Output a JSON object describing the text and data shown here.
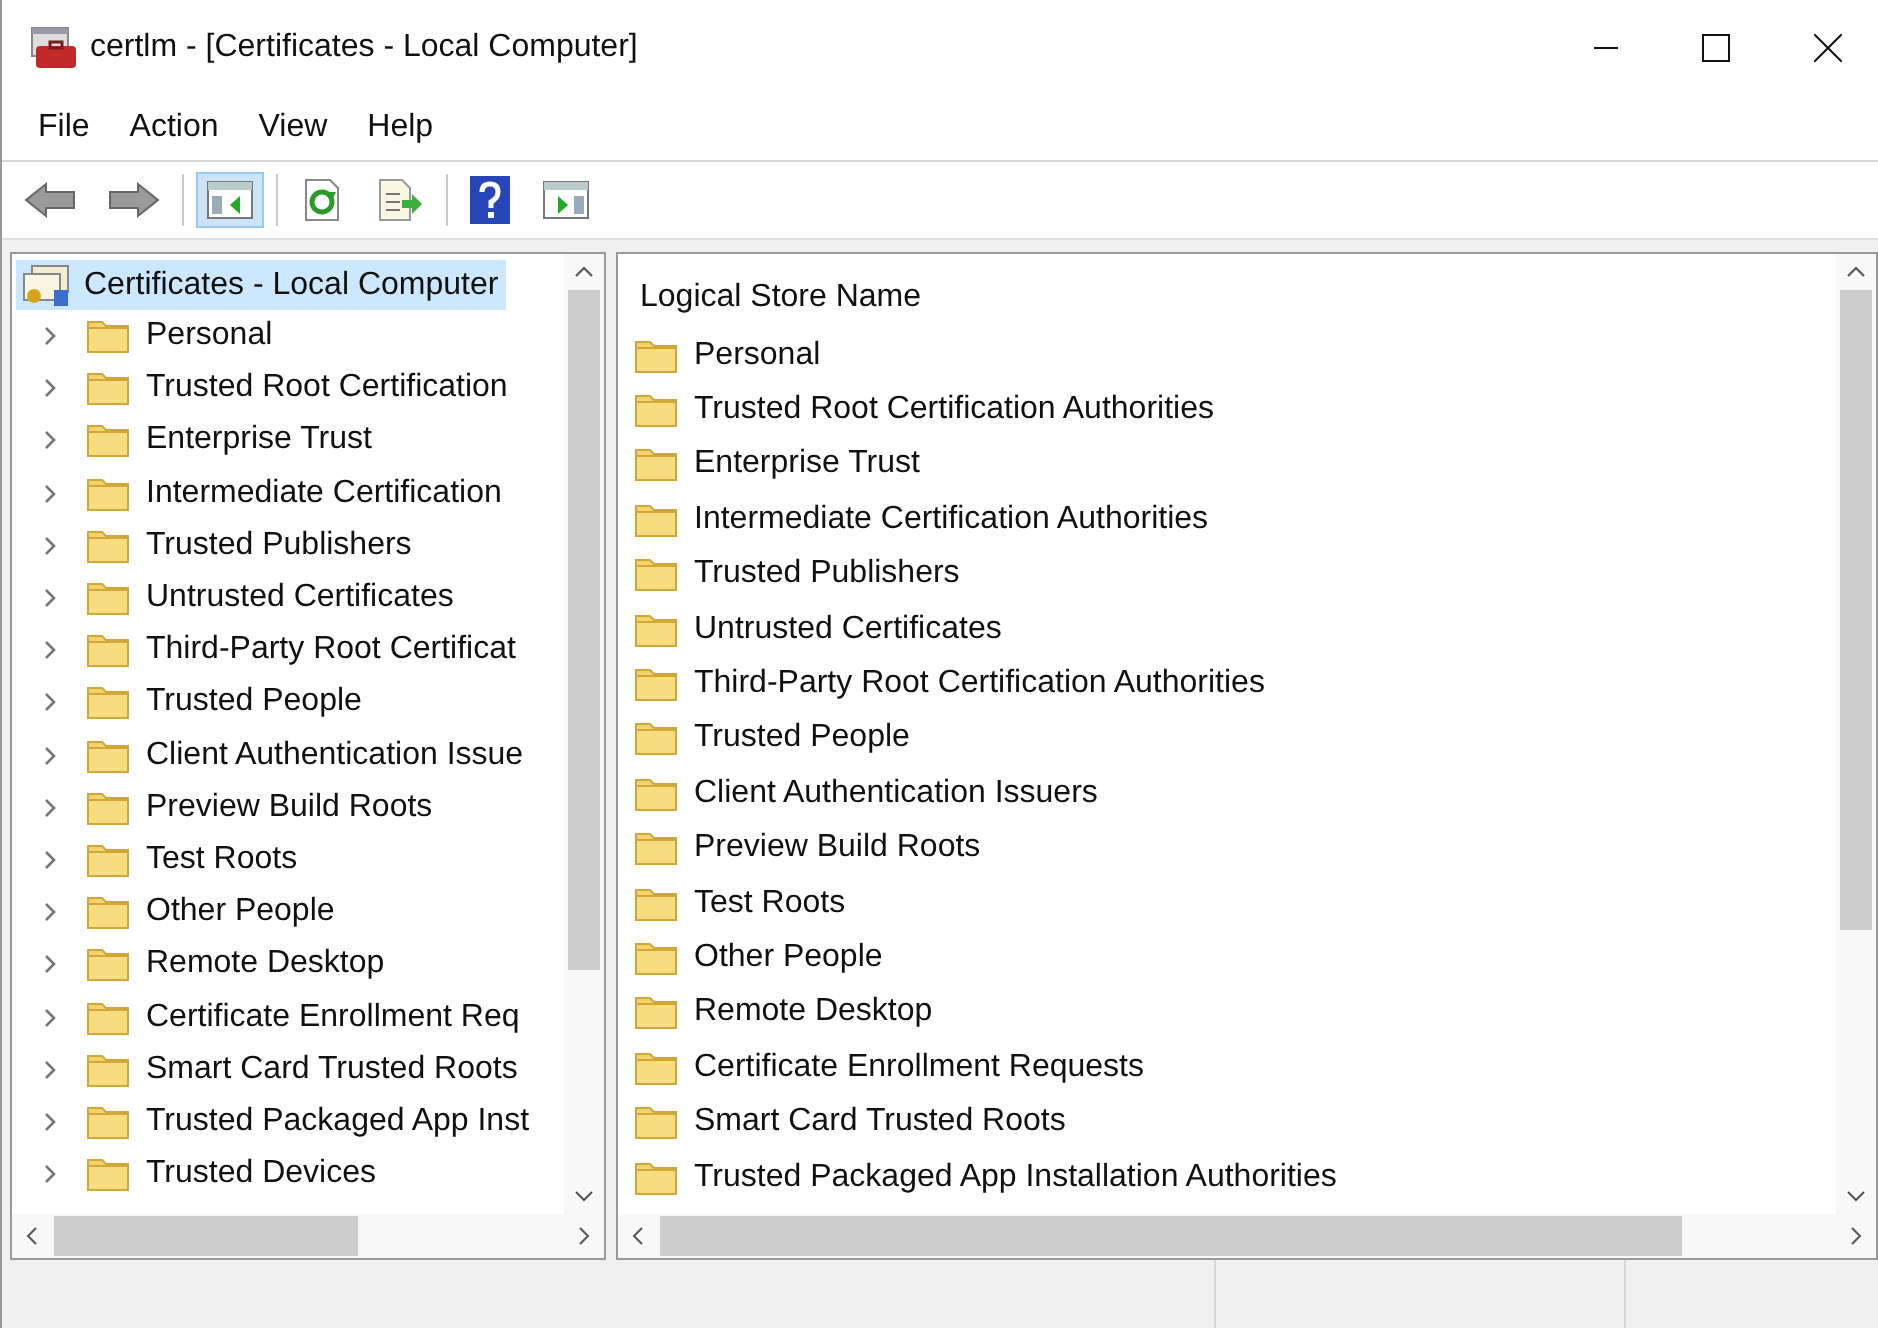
{
  "window": {
    "title": "certlm - [Certificates - Local Computer]"
  },
  "menu": [
    "File",
    "Action",
    "View",
    "Help"
  ],
  "toolbar": [
    {
      "kind": "back",
      "disabled": true
    },
    {
      "kind": "forward",
      "disabled": true
    },
    {
      "kind": "sep"
    },
    {
      "kind": "console-tree",
      "selected": true
    },
    {
      "kind": "sep"
    },
    {
      "kind": "refresh"
    },
    {
      "kind": "export"
    },
    {
      "kind": "sep"
    },
    {
      "kind": "help"
    },
    {
      "kind": "action-pane"
    }
  ],
  "tree": {
    "label": "Certificates - Local Computer",
    "selected": true,
    "children": [
      {
        "label": "Personal",
        "expanded": false
      },
      {
        "label": "Trusted Root Certification",
        "expanded": false
      },
      {
        "label": "Enterprise Trust",
        "expanded": false
      },
      {
        "label": "Intermediate Certification",
        "expanded": false
      },
      {
        "label": "Trusted Publishers",
        "expanded": false
      },
      {
        "label": "Untrusted Certificates",
        "expanded": false
      },
      {
        "label": "Third-Party Root Certificat",
        "expanded": false
      },
      {
        "label": "Trusted People",
        "expanded": false
      },
      {
        "label": "Client Authentication Issue",
        "expanded": false
      },
      {
        "label": "Preview Build Roots",
        "expanded": false
      },
      {
        "label": "Test Roots",
        "expanded": false
      },
      {
        "label": "Other People",
        "expanded": false
      },
      {
        "label": "Remote Desktop",
        "expanded": false
      },
      {
        "label": "Certificate Enrollment Req",
        "expanded": false
      },
      {
        "label": "Smart Card Trusted Roots",
        "expanded": false
      },
      {
        "label": "Trusted Packaged App Inst",
        "expanded": false
      },
      {
        "label": "Trusted Devices",
        "expanded": false
      }
    ]
  },
  "list": {
    "columns": [
      "Logical Store Name"
    ],
    "rows": [
      "Personal",
      "Trusted Root Certification Authorities",
      "Enterprise Trust",
      "Intermediate Certification Authorities",
      "Trusted Publishers",
      "Untrusted Certificates",
      "Third-Party Root Certification Authorities",
      "Trusted People",
      "Client Authentication Issuers",
      "Preview Build Roots",
      "Test Roots",
      "Other People",
      "Remote Desktop",
      "Certificate Enrollment Requests",
      "Smart Card Trusted Roots",
      "Trusted Packaged App Installation Authorities"
    ]
  }
}
